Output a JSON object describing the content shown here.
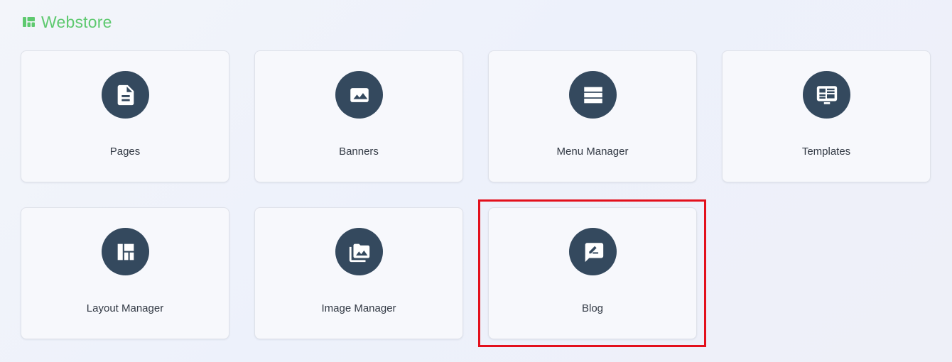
{
  "header": {
    "title": "Webstore",
    "icon": "layout-grid-icon"
  },
  "colors": {
    "accent_green": "#5ec96f",
    "icon_circle": "#34495e",
    "highlight_red": "#e3101c"
  },
  "cards": [
    {
      "label": "Pages",
      "icon": "document-icon"
    },
    {
      "label": "Banners",
      "icon": "image-icon"
    },
    {
      "label": "Menu Manager",
      "icon": "menu-bars-icon"
    },
    {
      "label": "Templates",
      "icon": "monitor-template-icon"
    },
    {
      "label": "Layout Manager",
      "icon": "layout-grid-icon"
    },
    {
      "label": "Image Manager",
      "icon": "image-library-icon"
    },
    {
      "label": "Blog",
      "icon": "comment-edit-icon",
      "highlighted": true
    }
  ]
}
